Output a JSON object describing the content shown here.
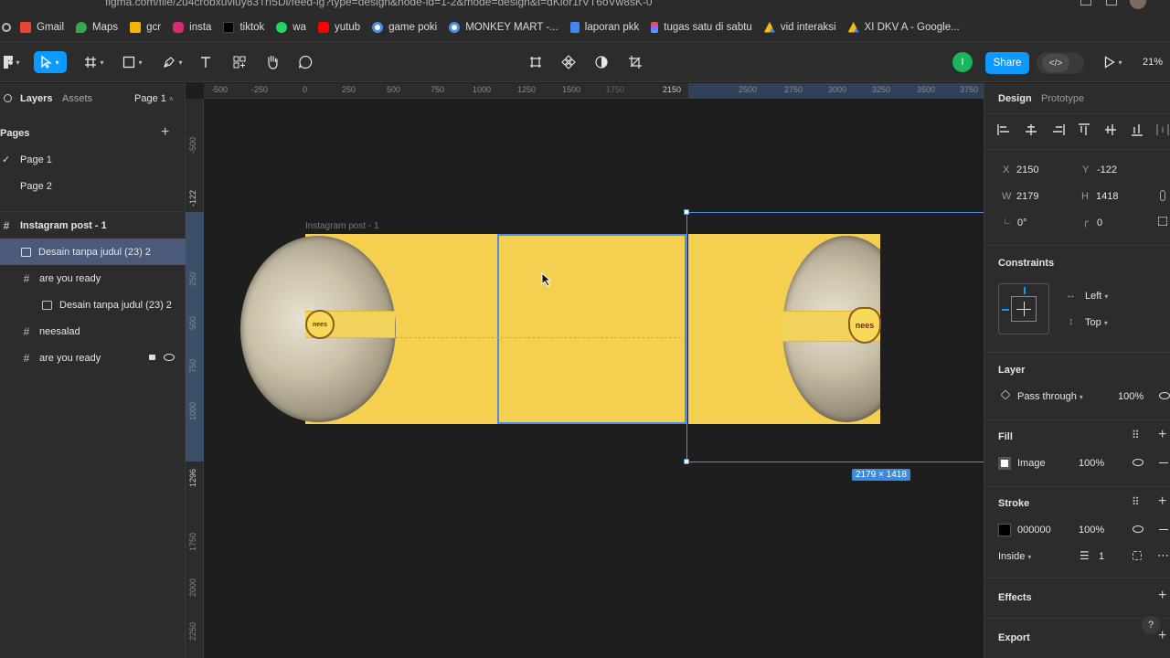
{
  "browser": {
    "url": "figma.com/file/2u4crobxuviuy83TrI5Di/feed-ig?type=design&node-id=1-2&mode=design&t=dKior1rVT6oVw8sK-0",
    "bookmarks": [
      {
        "label": "Gmail",
        "icon": "gmail-icon",
        "color": "#ea4335"
      },
      {
        "label": "Maps",
        "icon": "maps-icon",
        "color": "#34a853"
      },
      {
        "label": "gcr",
        "icon": "classroom-icon",
        "color": "#f4b400"
      },
      {
        "label": "insta",
        "icon": "instagram-icon",
        "color": "#d62976"
      },
      {
        "label": "tiktok",
        "icon": "tiktok-icon",
        "color": "#111111"
      },
      {
        "label": "wa",
        "icon": "whatsapp-icon",
        "color": "#25d366"
      },
      {
        "label": "yutub",
        "icon": "youtube-icon",
        "color": "#ff0000"
      },
      {
        "label": "game poki",
        "icon": "poki-icon",
        "color": "#4a90e2"
      },
      {
        "label": "MONKEY MART -...",
        "icon": "monkeymart-icon",
        "color": "#4a90e2"
      },
      {
        "label": "laporan pkk",
        "icon": "docs-icon",
        "color": "#4285f4"
      },
      {
        "label": "tugas satu di sabtu",
        "icon": "figma-icon",
        "color": "#f24e1e"
      },
      {
        "label": "vid interaksi",
        "icon": "drive-icon",
        "color": "#34a853"
      },
      {
        "label": "XI DKV A - Google...",
        "icon": "drive-icon",
        "color": "#fbbc04"
      }
    ]
  },
  "toolbar": {
    "share_label": "Share",
    "avatar_initial": "I",
    "zoom": "21%"
  },
  "left_panel": {
    "tab_layers": "Layers",
    "tab_assets": "Assets",
    "page_selector": "Page 1",
    "pages_heading": "Pages",
    "pages": [
      "Page 1",
      "Page 2"
    ],
    "layers": [
      {
        "label": "Instagram post - 1",
        "type": "frame"
      },
      {
        "label": "Desain tanpa judul (23) 2",
        "type": "image"
      },
      {
        "label": "are you ready",
        "type": "frame"
      },
      {
        "label": "Desain tanpa judul (23) 2",
        "type": "image"
      },
      {
        "label": "neesalad",
        "type": "frame"
      },
      {
        "label": "are you ready",
        "type": "frame"
      }
    ]
  },
  "rulers": {
    "h_ticks": [
      "-500",
      "-250",
      "0",
      "250",
      "500",
      "750",
      "1000",
      "1250",
      "1500",
      "1750",
      "2150",
      "2500",
      "2750",
      "3000",
      "3250",
      "3500",
      "3750"
    ],
    "v_ticks": [
      "-500",
      "-122",
      "250",
      "500",
      "750",
      "1000",
      "1296",
      "1750",
      "2000",
      "2250"
    ]
  },
  "canvas": {
    "frame_label": "Instagram post - 1",
    "dimension_badge": "2179 × 1418",
    "logo_text": "nees"
  },
  "right_panel": {
    "tab_design": "Design",
    "tab_prototype": "Prototype",
    "x_label": "X",
    "x_value": "2150",
    "y_label": "Y",
    "y_value": "-122",
    "w_label": "W",
    "w_value": "2179",
    "h_label": "H",
    "h_value": "1418",
    "rotation": "0°",
    "radius": "0",
    "constraints_heading": "Constraints",
    "constraint_h": "Left",
    "constraint_v": "Top",
    "layer_heading": "Layer",
    "blend_mode": "Pass through",
    "layer_opacity": "100%",
    "fill_heading": "Fill",
    "fill_type": "Image",
    "fill_opacity": "100%",
    "stroke_heading": "Stroke",
    "stroke_color": "000000",
    "stroke_opacity": "100%",
    "stroke_position": "Inside",
    "stroke_weight": "1",
    "effects_heading": "Effects",
    "export_heading": "Export",
    "help": "?"
  },
  "colors": {
    "accent": "#0d99ff",
    "artwork_yellow": "#f5cf4f",
    "selection_blue": "#4c8fe0"
  }
}
